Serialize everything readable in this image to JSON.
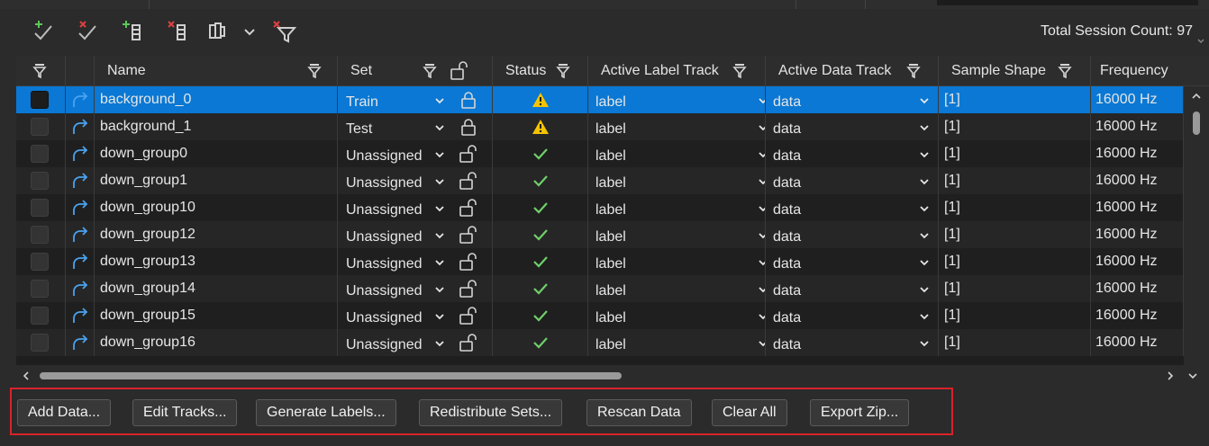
{
  "toolbar": {
    "icons": [
      "add-check-icon",
      "remove-check-icon",
      "add-column-icon",
      "remove-column-icon",
      "column-settings-icon",
      "chevron-down-icon",
      "clear-filter-icon"
    ],
    "session_count": "Total Session Count: 97"
  },
  "columns": {
    "name": "Name",
    "set": "Set",
    "status": "Status",
    "label_track": "Active Label Track",
    "data_track": "Active Data Track",
    "shape": "Sample Shape",
    "frequency": "Frequency"
  },
  "rows": [
    {
      "name": "background_0",
      "set": "Train",
      "status": "warning",
      "label": "label",
      "data": "data",
      "shape": "[1]",
      "freq": "16000 Hz",
      "locked": true,
      "selected": true
    },
    {
      "name": "background_1",
      "set": "Test",
      "status": "warning",
      "label": "label",
      "data": "data",
      "shape": "[1]",
      "freq": "16000 Hz",
      "locked": true,
      "selected": false
    },
    {
      "name": "down_group0",
      "set": "Unassigned",
      "status": "ok",
      "label": "label",
      "data": "data",
      "shape": "[1]",
      "freq": "16000 Hz",
      "locked": false,
      "selected": false
    },
    {
      "name": "down_group1",
      "set": "Unassigned",
      "status": "ok",
      "label": "label",
      "data": "data",
      "shape": "[1]",
      "freq": "16000 Hz",
      "locked": false,
      "selected": false
    },
    {
      "name": "down_group10",
      "set": "Unassigned",
      "status": "ok",
      "label": "label",
      "data": "data",
      "shape": "[1]",
      "freq": "16000 Hz",
      "locked": false,
      "selected": false
    },
    {
      "name": "down_group12",
      "set": "Unassigned",
      "status": "ok",
      "label": "label",
      "data": "data",
      "shape": "[1]",
      "freq": "16000 Hz",
      "locked": false,
      "selected": false
    },
    {
      "name": "down_group13",
      "set": "Unassigned",
      "status": "ok",
      "label": "label",
      "data": "data",
      "shape": "[1]",
      "freq": "16000 Hz",
      "locked": false,
      "selected": false
    },
    {
      "name": "down_group14",
      "set": "Unassigned",
      "status": "ok",
      "label": "label",
      "data": "data",
      "shape": "[1]",
      "freq": "16000 Hz",
      "locked": false,
      "selected": false
    },
    {
      "name": "down_group15",
      "set": "Unassigned",
      "status": "ok",
      "label": "label",
      "data": "data",
      "shape": "[1]",
      "freq": "16000 Hz",
      "locked": false,
      "selected": false
    },
    {
      "name": "down_group16",
      "set": "Unassigned",
      "status": "ok",
      "label": "label",
      "data": "data",
      "shape": "[1]",
      "freq": "16000 Hz",
      "locked": false,
      "selected": false
    }
  ],
  "buttons": {
    "add_data": "Add Data...",
    "edit_tracks": "Edit Tracks...",
    "generate_labels": "Generate Labels...",
    "redistribute_sets": "Redistribute Sets...",
    "rescan_data": "Rescan Data",
    "clear_all": "Clear All",
    "export_zip": "Export Zip..."
  },
  "colors": {
    "selection": "#0a78d4",
    "ok": "#6fcf6a",
    "warning": "#f5c400",
    "link_icon": "#4aa3f0",
    "highlight_border": "#d8232a"
  }
}
